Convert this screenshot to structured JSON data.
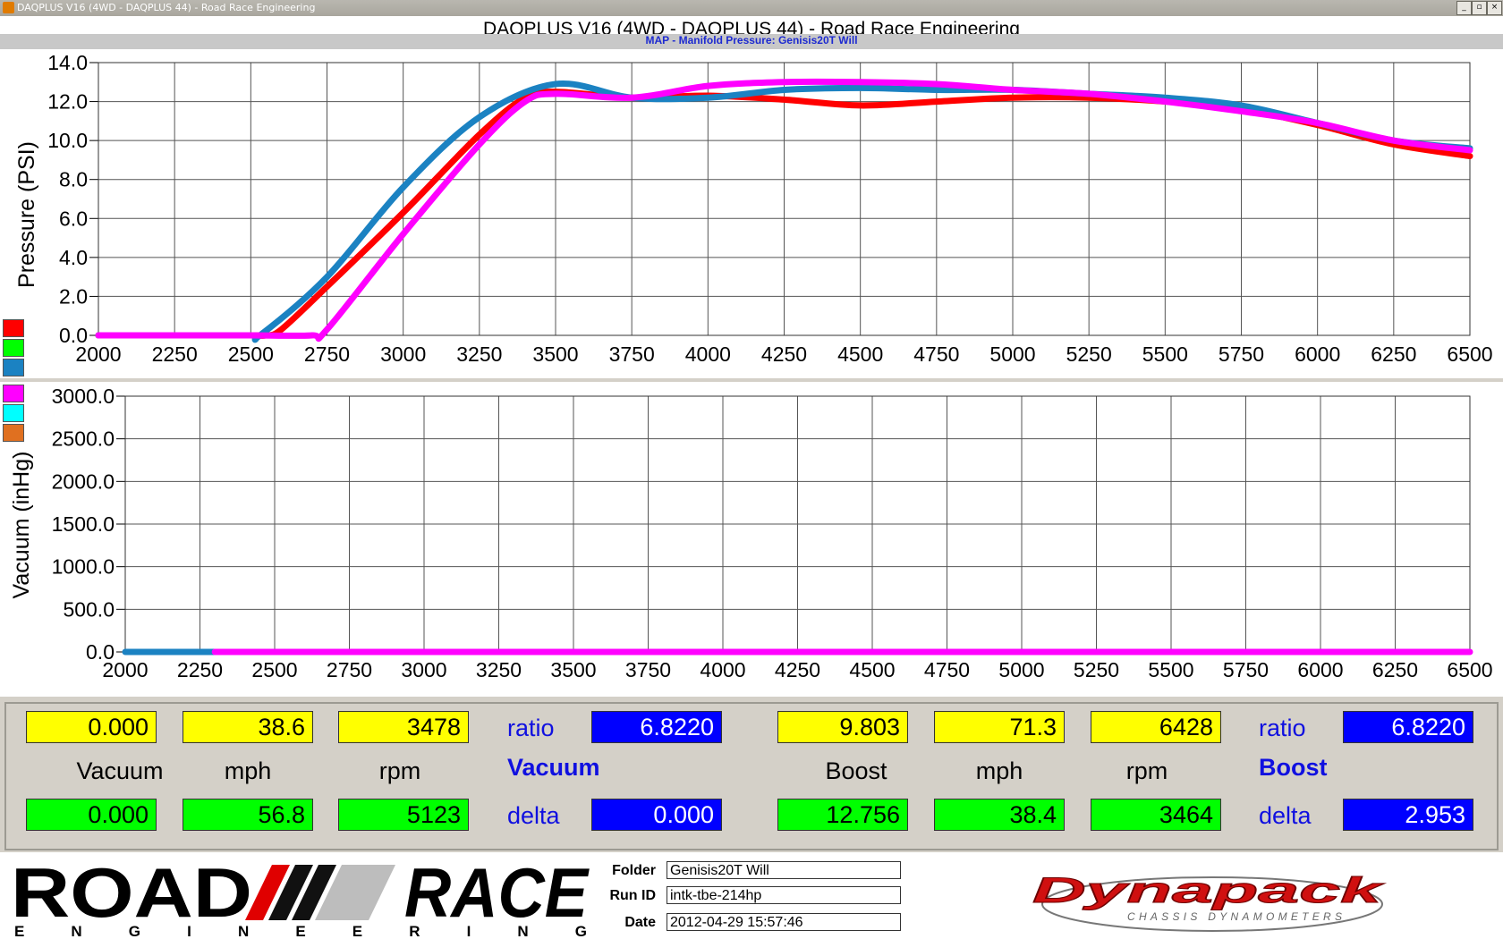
{
  "window": {
    "title": "DAQPLUS V16 (4WD - DAQPLUS 44) - Road Race Engineering",
    "buttons": [
      "_",
      "▫",
      "×"
    ]
  },
  "header": {
    "app_title": "DAQPLUS V16 (4WD - DAQPLUS 44) - Road Race Engineering",
    "subtitle": "MAP - Manifold Pressure: Genisis20T Will"
  },
  "colors": {
    "red": "#ff0000",
    "green": "#00ff00",
    "blue": "#1b82c2",
    "magenta": "#ff00ff",
    "cyan": "#00ffff",
    "orange": "#e07020",
    "readout_blue_label": "#1010e0"
  },
  "legend_swatches": [
    "red",
    "green",
    "blue",
    "magenta",
    "cyan",
    "orange"
  ],
  "chart_data": [
    {
      "type": "line",
      "ylabel": "Pressure (PSI)",
      "xlim": [
        2000,
        6500
      ],
      "ylim": [
        0,
        14
      ],
      "x_ticks": [
        "2000",
        "2250",
        "2500",
        "2750",
        "3000",
        "3250",
        "3500",
        "3750",
        "4000",
        "4250",
        "4500",
        "4750",
        "5000",
        "5250",
        "5500",
        "5750",
        "6000",
        "6250",
        "6500"
      ],
      "y_ticks": [
        "0.0",
        "2.0",
        "4.0",
        "6.0",
        "8.0",
        "10.0",
        "12.0",
        "14.0"
      ],
      "grid": true,
      "series": [
        {
          "color": "red",
          "points": [
            [
              2000,
              0
            ],
            [
              2250,
              0
            ],
            [
              2500,
              0
            ],
            [
              2550,
              0
            ],
            [
              2600,
              0.3
            ],
            [
              2750,
              2.5
            ],
            [
              3000,
              6.3
            ],
            [
              3250,
              10.3
            ],
            [
              3400,
              12.2
            ],
            [
              3500,
              12.5
            ],
            [
              3750,
              12.2
            ],
            [
              4000,
              12.3
            ],
            [
              4250,
              12.1
            ],
            [
              4500,
              11.8
            ],
            [
              4750,
              12.0
            ],
            [
              5000,
              12.2
            ],
            [
              5250,
              12.2
            ],
            [
              5500,
              12.0
            ],
            [
              5750,
              11.6
            ],
            [
              6000,
              10.8
            ],
            [
              6250,
              9.8
            ],
            [
              6500,
              9.2
            ]
          ]
        },
        {
          "color": "blue",
          "points": [
            [
              2000,
              0
            ],
            [
              2250,
              0
            ],
            [
              2500,
              0
            ],
            [
              2530,
              0
            ],
            [
              2750,
              3.0
            ],
            [
              3000,
              7.6
            ],
            [
              3250,
              11.2
            ],
            [
              3500,
              12.9
            ],
            [
              3750,
              12.2
            ],
            [
              4000,
              12.2
            ],
            [
              4250,
              12.6
            ],
            [
              4500,
              12.7
            ],
            [
              4750,
              12.6
            ],
            [
              5000,
              12.6
            ],
            [
              5250,
              12.4
            ],
            [
              5500,
              12.2
            ],
            [
              5750,
              11.8
            ],
            [
              6000,
              10.9
            ],
            [
              6250,
              10.0
            ],
            [
              6500,
              9.6
            ]
          ]
        },
        {
          "color": "magenta",
          "points": [
            [
              2000,
              0
            ],
            [
              2300,
              0
            ],
            [
              2500,
              0
            ],
            [
              2700,
              0
            ],
            [
              2750,
              0.3
            ],
            [
              3000,
              5.2
            ],
            [
              3250,
              9.8
            ],
            [
              3400,
              12.0
            ],
            [
              3500,
              12.4
            ],
            [
              3750,
              12.2
            ],
            [
              4000,
              12.8
            ],
            [
              4250,
              13.0
            ],
            [
              4500,
              13.0
            ],
            [
              4750,
              12.9
            ],
            [
              5000,
              12.6
            ],
            [
              5250,
              12.4
            ],
            [
              5500,
              12.0
            ],
            [
              5750,
              11.5
            ],
            [
              6000,
              10.9
            ],
            [
              6250,
              10.0
            ],
            [
              6500,
              9.5
            ]
          ]
        }
      ]
    },
    {
      "type": "line",
      "ylabel": "Vacuum (inHg)",
      "xlim": [
        2000,
        6500
      ],
      "ylim": [
        0,
        3000
      ],
      "x_ticks": [
        "2000",
        "2250",
        "2500",
        "2750",
        "3000",
        "3250",
        "3500",
        "3750",
        "4000",
        "4250",
        "4500",
        "4750",
        "5000",
        "5250",
        "5500",
        "5750",
        "6000",
        "6250",
        "6500"
      ],
      "y_ticks": [
        "0.0",
        "500.0",
        "1000.0",
        "1500.0",
        "2000.0",
        "2500.0",
        "3000.0"
      ],
      "grid": true,
      "series": [
        {
          "color": "blue",
          "points": [
            [
              2000,
              0
            ],
            [
              2300,
              0
            ]
          ]
        },
        {
          "color": "magenta",
          "points": [
            [
              2300,
              0
            ],
            [
              6500,
              0
            ]
          ]
        }
      ]
    }
  ],
  "readouts": {
    "left": {
      "top": [
        "0.000",
        "38.6",
        "3478"
      ],
      "ratio_label": "ratio",
      "ratio_value": "6.8220",
      "labels": [
        "Vacuum",
        "mph",
        "rpm"
      ],
      "section_label": "Vacuum",
      "bottom": [
        "0.000",
        "56.8",
        "5123"
      ],
      "delta_label": "delta",
      "delta_value": "0.000"
    },
    "right": {
      "top": [
        "9.803",
        "71.3",
        "6428"
      ],
      "ratio_label": "ratio",
      "ratio_value": "6.8220",
      "labels": [
        "Boost",
        "mph",
        "rpm"
      ],
      "section_label": "Boost",
      "bottom": [
        "12.756",
        "38.4",
        "3464"
      ],
      "delta_label": "delta",
      "delta_value": "2.953"
    }
  },
  "footer": {
    "logo_top": "ROAD",
    "logo_top2": "RACE",
    "logo_sub": "E N G I N E E R I N G",
    "folder_label": "Folder",
    "folder_value": "Genisis20T Will",
    "runid_label": "Run ID",
    "runid_value": "intk-tbe-214hp",
    "date_label": "Date",
    "date_value": "2012-04-29 15:57:46",
    "dyno_brand": "Dynapack",
    "dyno_sub": "CHASSIS DYNAMOMETERS"
  }
}
